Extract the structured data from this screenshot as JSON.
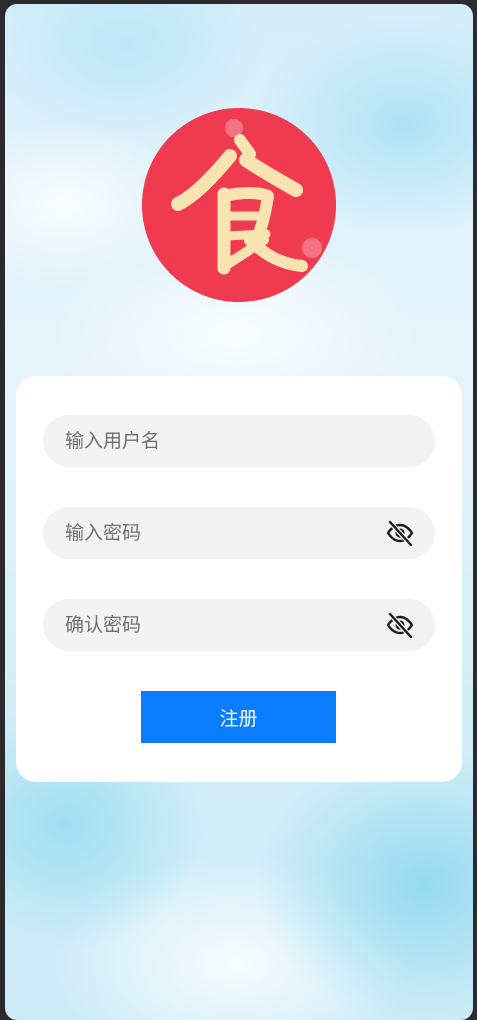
{
  "logo": {
    "glyph": "食",
    "background_color": "#f03a4f",
    "glyph_color": "#f9e3b0"
  },
  "form": {
    "username_placeholder": "输入用户名",
    "password_placeholder": "输入密码",
    "confirm_password_placeholder": "确认密码",
    "password_toggle_icon": "eye-slash-icon",
    "register_label": "注册"
  },
  "colors": {
    "accent": "#0a7dff",
    "field_background": "#f2f3f2",
    "card_background": "#ffffff"
  }
}
